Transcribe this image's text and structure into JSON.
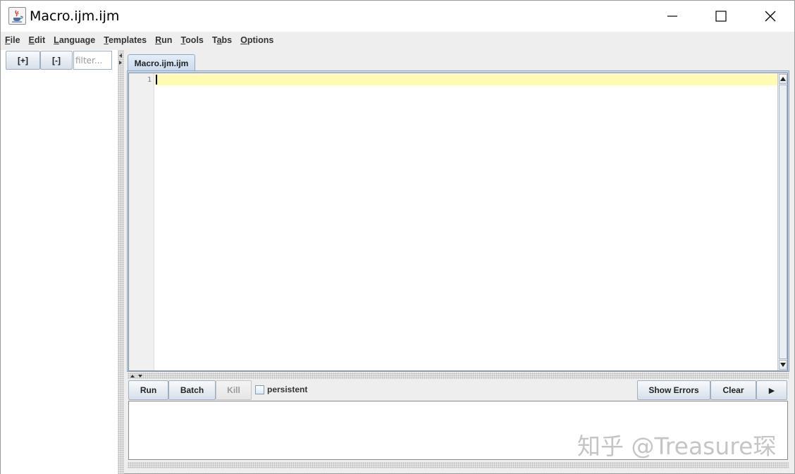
{
  "window": {
    "title": "Macro.ijm.ijm"
  },
  "menu": {
    "items": [
      {
        "mn": "F",
        "rest": "ile"
      },
      {
        "mn": "E",
        "rest": "dit"
      },
      {
        "mn": "L",
        "rest": "anguage"
      },
      {
        "mn": "T",
        "rest": "emplates"
      },
      {
        "mn": "R",
        "rest": "un"
      },
      {
        "mn": "T",
        "rest": "ools"
      },
      {
        "pre": "T",
        "mn": "a",
        "rest": "bs"
      },
      {
        "mn": "O",
        "rest": "ptions"
      }
    ]
  },
  "tree": {
    "expand_label": "[+]",
    "collapse_label": "[-]",
    "filter_placeholder": "filter..."
  },
  "editor": {
    "tab_label": "Macro.ijm.ijm",
    "line_numbers": [
      "1"
    ],
    "content": ""
  },
  "toolbar": {
    "run": "Run",
    "batch": "Batch",
    "kill": "Kill",
    "persistent": "persistent",
    "persistent_checked": false,
    "show_errors": "Show Errors",
    "clear": "Clear",
    "next_arrow": "▶"
  },
  "watermark": "知乎 @Treasure琛",
  "colors": {
    "current_line": "#fffbb3",
    "button_border": "#9eaec1",
    "tab_fill": "#c9d9ed"
  }
}
